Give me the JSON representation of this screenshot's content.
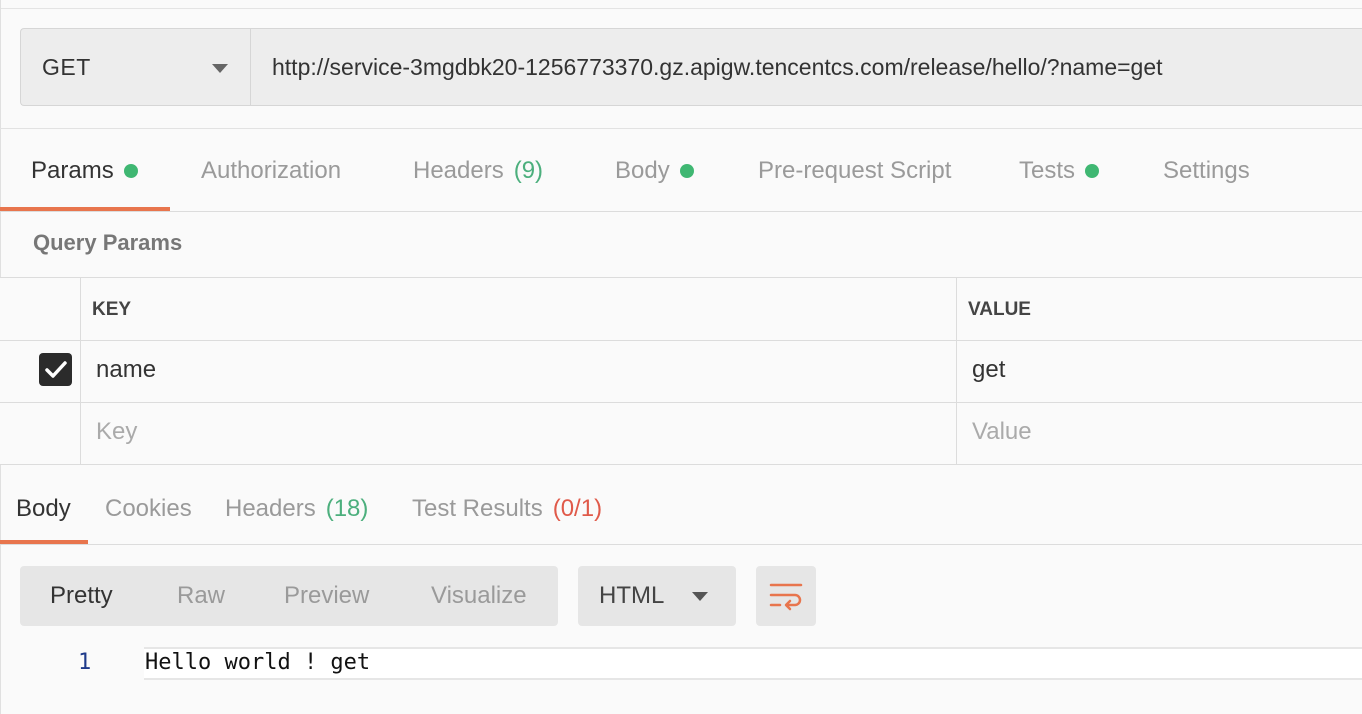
{
  "request": {
    "method": "GET",
    "url": "http://service-3mgdbk20-1256773370.gz.apigw.tencentcs.com/release/hello/?name=get"
  },
  "request_tabs": [
    {
      "label": "Params",
      "dot": true,
      "active": true
    },
    {
      "label": "Authorization"
    },
    {
      "label": "Headers",
      "count": "(9)"
    },
    {
      "label": "Body",
      "dot": true
    },
    {
      "label": "Pre-request Script"
    },
    {
      "label": "Tests",
      "dot": true
    },
    {
      "label": "Settings"
    }
  ],
  "query_params": {
    "title": "Query Params",
    "headers": {
      "key": "KEY",
      "value": "VALUE"
    },
    "rows": [
      {
        "checked": true,
        "key": "name",
        "value": "get"
      }
    ],
    "placeholders": {
      "key": "Key",
      "value": "Value"
    }
  },
  "response_tabs": [
    {
      "label": "Body",
      "active": true
    },
    {
      "label": "Cookies"
    },
    {
      "label": "Headers",
      "count": "(18)"
    },
    {
      "label": "Test Results",
      "count": "(0/1)",
      "count_color": "#e05a4a"
    }
  ],
  "response_view": {
    "modes": [
      "Pretty",
      "Raw",
      "Preview",
      "Visualize"
    ],
    "active_mode": "Pretty",
    "language": "HTML"
  },
  "response_body": {
    "lines": [
      {
        "number": "1",
        "text": "Hello world ! get"
      }
    ]
  },
  "colors": {
    "accent": "#e8754d",
    "dot_green": "#3fb772",
    "count_green": "#4caf7d",
    "error_red": "#e05a4a"
  }
}
